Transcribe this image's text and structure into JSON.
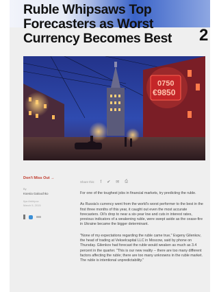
{
  "headline": "Ruble Whipsaws Top Forecasters as Worst Currency Becomes Best",
  "issue_number": "2",
  "photo": {
    "sign_rate_1": "0750",
    "sign_rate_2": "9850"
  },
  "sidebar": {
    "dont_miss": "Don't Miss Out →",
    "by_label": "By",
    "author": "Ksenia Galouchko",
    "meta_1": "Ilya Arkhipov",
    "meta_2": "March 5, 2015",
    "social_icons": [
      "email-icon",
      "twitter-icon",
      "share-icon"
    ]
  },
  "share_bar": {
    "label": "Share this:",
    "icons": [
      "facebook-icon",
      "twitter-icon",
      "email-icon",
      "print-icon"
    ]
  },
  "article": {
    "paragraphs": [
      "For one of the toughest jobs in financial markets, try predicting the ruble.",
      "As Russia's currency went from the world's worst performer to the best in the first three months of this year, it caught out even the most accurate forecasters. Oil's drop to near a six-year low and cuts in interest rates, previous indicators of a weakening ruble, were swept aside as the cease-fire in Ukraine became the bigger determinant.",
      "\"None of my expectations regarding the ruble came true,\" Evgeny Gilenkov, the head of trading at Vekselcapital LLC in Moscow, said by phone on Thursday. Gilenkov had forecast the ruble would weaken as much as 3.4 percent in the quarter. \"This is our new reality -- there are too many different factors affecting the ruble; there are too many unknowns in the ruble market. The ruble is intentional unpredictability.\""
    ]
  }
}
